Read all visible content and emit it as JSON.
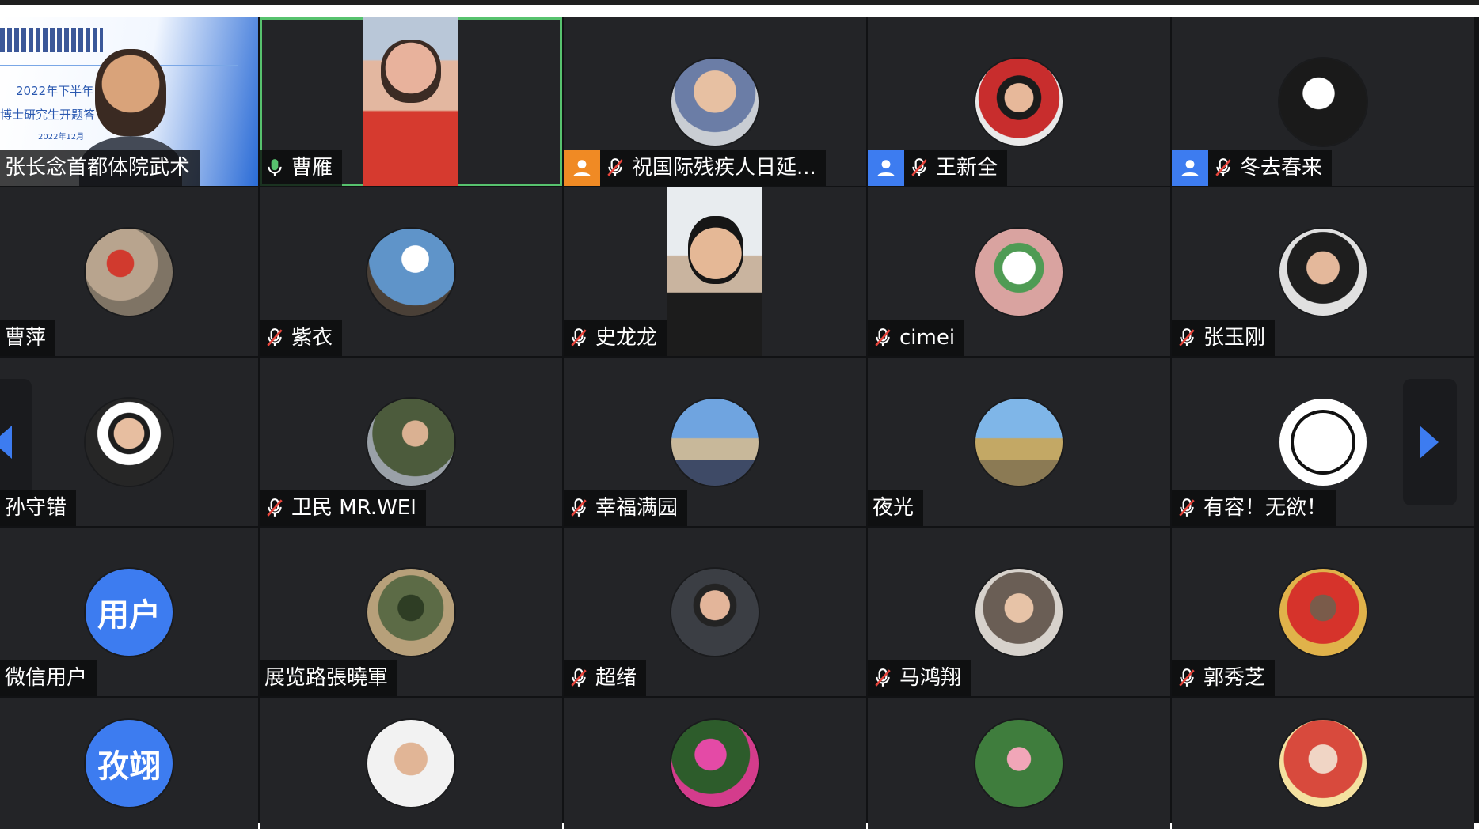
{
  "colors": {
    "tile_bg": "#232427",
    "grid_bg": "#111214",
    "active_border": "#57c26e",
    "host_blue": "#3d7cf0",
    "host_orange": "#f08a24",
    "mic_red": "#f2f2f2"
  },
  "screen_share": {
    "title": "2022年下半年",
    "subtitle": "博士研究生开题答",
    "date": "2022年12月"
  },
  "participants": [
    {
      "name": "张长念首都体院武术",
      "tile": "screen-share",
      "muted": false,
      "mic": false,
      "host_badge": ""
    },
    {
      "name": "曹雁",
      "tile": "camera-red",
      "active": true,
      "mic": true,
      "muted": false,
      "host_badge": ""
    },
    {
      "name": "祝国际残疾人日延...",
      "tile": "avatar",
      "muted": true,
      "host_badge": "orange"
    },
    {
      "name": "王新全",
      "tile": "avatar",
      "muted": true,
      "host_badge": "blue"
    },
    {
      "name": "冬去春来",
      "tile": "avatar",
      "muted": true,
      "host_badge": "blue"
    },
    {
      "name": "曹萍",
      "tile": "avatar",
      "muted": false
    },
    {
      "name": "紫衣",
      "tile": "avatar",
      "muted": true
    },
    {
      "name": "史龙龙",
      "tile": "camera-man",
      "muted": true
    },
    {
      "name": "cimei",
      "tile": "avatar",
      "muted": true
    },
    {
      "name": "张玉刚",
      "tile": "avatar",
      "muted": true
    },
    {
      "name": "孙守错",
      "tile": "avatar",
      "muted": false
    },
    {
      "name": "卫民 MR.WEI",
      "tile": "avatar",
      "muted": true
    },
    {
      "name": "幸福满园",
      "tile": "avatar",
      "muted": true
    },
    {
      "name": "夜光",
      "tile": "avatar",
      "muted": false
    },
    {
      "name": "有容！无欲！",
      "tile": "avatar",
      "muted": true
    },
    {
      "name": "微信用户",
      "tile": "avatar-text",
      "avatar_text": "用户",
      "muted": false
    },
    {
      "name": "展览路張曉軍",
      "tile": "avatar",
      "muted": false
    },
    {
      "name": "超绪",
      "tile": "avatar",
      "muted": true
    },
    {
      "name": "马鸿翔",
      "tile": "avatar",
      "muted": true
    },
    {
      "name": "郭秀芝",
      "tile": "avatar",
      "muted": true
    },
    {
      "name": "",
      "tile": "avatar-text",
      "avatar_text": "孜翊",
      "muted": false
    },
    {
      "name": "",
      "tile": "avatar",
      "muted": false
    },
    {
      "name": "",
      "tile": "avatar",
      "muted": false
    },
    {
      "name": "",
      "tile": "avatar",
      "muted": false
    },
    {
      "name": "",
      "tile": "avatar",
      "muted": false
    }
  ],
  "nav": {
    "prev_icon": "chevron-left-icon",
    "next_icon": "chevron-right-icon"
  }
}
